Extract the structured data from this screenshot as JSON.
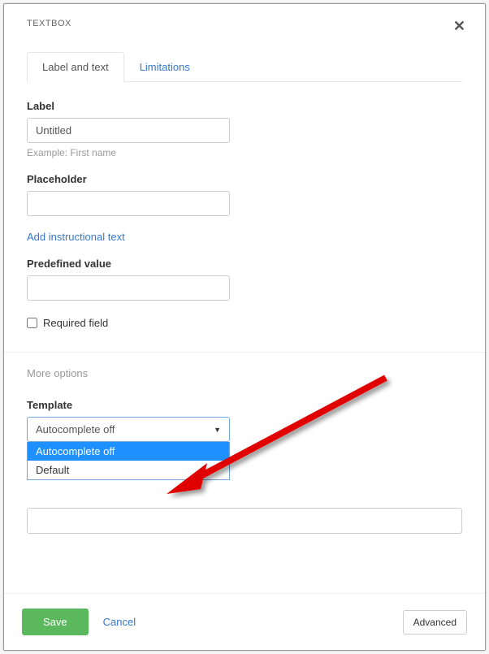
{
  "header": {
    "title": "TEXTBOX"
  },
  "tabs": {
    "active": "Label and text",
    "inactive": "Limitations"
  },
  "form": {
    "label_title": "Label",
    "label_value": "Untitled",
    "label_help": "Example: First name",
    "placeholder_title": "Placeholder",
    "placeholder_value": "",
    "instructional_link": "Add instructional text",
    "predefined_title": "Predefined value",
    "predefined_value": "",
    "required_label": "Required field"
  },
  "more": {
    "header": "More options",
    "template_title": "Template",
    "template_selected": "Autocomplete off",
    "options": {
      "opt0": "Autocomplete off",
      "opt1": "Default"
    }
  },
  "footer": {
    "save": "Save",
    "cancel": "Cancel",
    "advanced": "Advanced"
  }
}
